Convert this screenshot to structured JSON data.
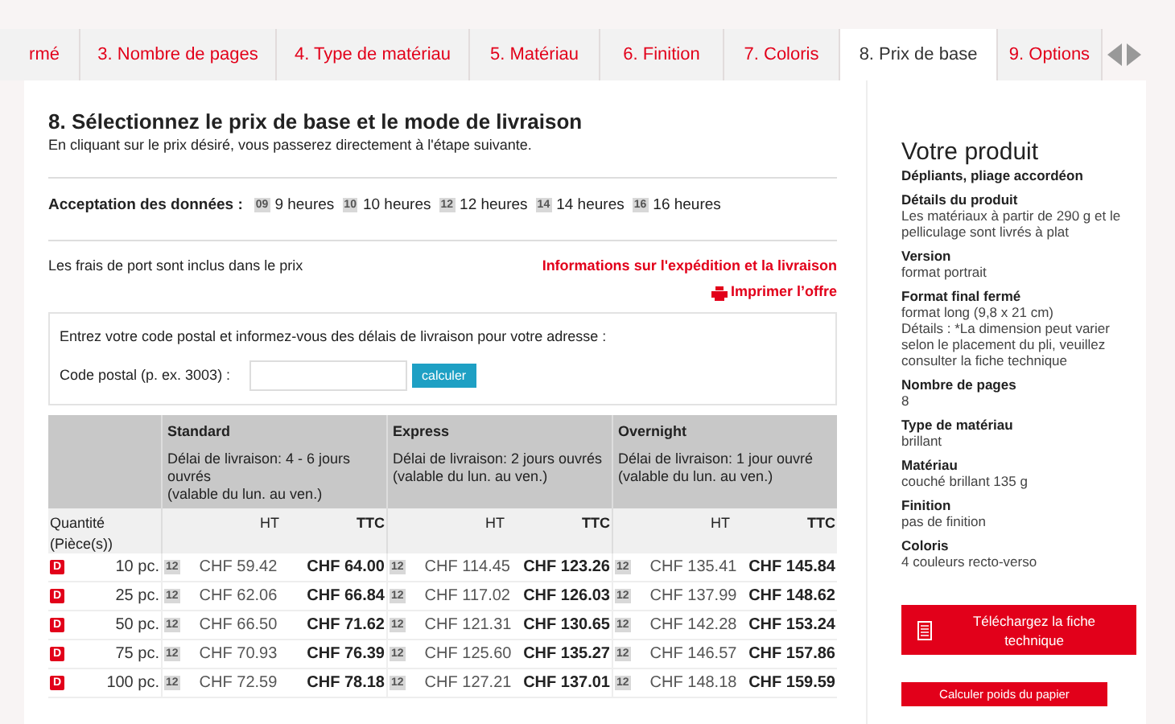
{
  "tabs": [
    {
      "label": "rmé",
      "selected": false
    },
    {
      "label": "3. Nombre de pages",
      "selected": false
    },
    {
      "label": "4. Type de matériau",
      "selected": false
    },
    {
      "label": "5. Matériau",
      "selected": false
    },
    {
      "label": "6. Finition",
      "selected": false
    },
    {
      "label": "7. Coloris",
      "selected": false
    },
    {
      "label": "8. Prix de base",
      "selected": true
    },
    {
      "label": "9. Options",
      "selected": false
    }
  ],
  "heading": "8. Sélectionnez le prix de base et le mode de livraison",
  "subheading": "En cliquant sur le prix désiré, vous passerez directement à l'étape suivante.",
  "acceptance": {
    "label": "Acceptation des données :",
    "times": [
      {
        "badge": "09",
        "label": "9 heures"
      },
      {
        "badge": "10",
        "label": "10 heures"
      },
      {
        "badge": "12",
        "label": "12 heures"
      },
      {
        "badge": "14",
        "label": "14 heures"
      },
      {
        "badge": "16",
        "label": "16 heures"
      }
    ]
  },
  "shipping_note": "Les frais de port sont inclus dans le prix",
  "shipping_link": "Informations sur l'expédition et la livraison",
  "print_link": "Imprimer l’offre",
  "postal": {
    "intro": "Entrez votre code postal et informez-vous des délais de livraison pour votre adresse :",
    "label": "Code postal (p. ex. 3003) :",
    "button": "calculer"
  },
  "table": {
    "options": [
      {
        "name": "Standard",
        "delay": "Délai de livraison: 4 - 6 jours ouvrés",
        "note": "(valable du lun. au ven.)",
        "ht": "HT",
        "ttc": "TTC"
      },
      {
        "name": "Express",
        "delay": "Délai de livraison: 2 jours ouvrés",
        "note": "(valable du lun. au ven.)",
        "ht": "HT",
        "ttc": "TTC"
      },
      {
        "name": "Overnight",
        "delay": "Délai de livraison: 1 jour ouvré",
        "note": "(valable du lun. au ven.)",
        "ht": "HT",
        "ttc": "TTC"
      }
    ],
    "quantity_header": "Quantité (Pièce(s))",
    "rows": [
      {
        "flag": "D",
        "qty": "10 pc.",
        "prices": [
          {
            "badge": "12",
            "ht": "CHF 59.42",
            "ttc": "CHF 64.00"
          },
          {
            "badge": "12",
            "ht": "CHF 114.45",
            "ttc": "CHF 123.26"
          },
          {
            "badge": "12",
            "ht": "CHF 135.41",
            "ttc": "CHF 145.84"
          }
        ]
      },
      {
        "flag": "D",
        "qty": "25 pc.",
        "prices": [
          {
            "badge": "12",
            "ht": "CHF 62.06",
            "ttc": "CHF 66.84"
          },
          {
            "badge": "12",
            "ht": "CHF 117.02",
            "ttc": "CHF 126.03"
          },
          {
            "badge": "12",
            "ht": "CHF 137.99",
            "ttc": "CHF 148.62"
          }
        ]
      },
      {
        "flag": "D",
        "qty": "50 pc.",
        "prices": [
          {
            "badge": "12",
            "ht": "CHF 66.50",
            "ttc": "CHF 71.62"
          },
          {
            "badge": "12",
            "ht": "CHF 121.31",
            "ttc": "CHF 130.65"
          },
          {
            "badge": "12",
            "ht": "CHF 142.28",
            "ttc": "CHF 153.24"
          }
        ]
      },
      {
        "flag": "D",
        "qty": "75 pc.",
        "prices": [
          {
            "badge": "12",
            "ht": "CHF 70.93",
            "ttc": "CHF 76.39"
          },
          {
            "badge": "12",
            "ht": "CHF 125.60",
            "ttc": "CHF 135.27"
          },
          {
            "badge": "12",
            "ht": "CHF 146.57",
            "ttc": "CHF 157.86"
          }
        ]
      },
      {
        "flag": "D",
        "qty": "100 pc.",
        "prices": [
          {
            "badge": "12",
            "ht": "CHF 72.59",
            "ttc": "CHF 78.18"
          },
          {
            "badge": "12",
            "ht": "CHF 127.21",
            "ttc": "CHF 137.01"
          },
          {
            "badge": "12",
            "ht": "CHF 148.18",
            "ttc": "CHF 159.59"
          }
        ]
      }
    ]
  },
  "product": {
    "title": "Votre produit",
    "name": "Dépliants, pliage accordéon",
    "details": [
      {
        "label": "Détails du produit",
        "value": "Les matériaux à partir de 290 g et le pelliculage sont livrés à plat"
      },
      {
        "label": "Version",
        "value": "format portrait"
      },
      {
        "label": "Format final fermé",
        "value": "format long (9,8 x 21 cm)",
        "note": "Détails : *La dimension peut varier selon le placement du pli, veuillez consulter la fiche technique"
      },
      {
        "label": "Nombre de pages",
        "value": "8"
      },
      {
        "label": "Type de matériau",
        "value": "brillant"
      },
      {
        "label": "Matériau",
        "value": "couché brillant 135 g"
      },
      {
        "label": "Finition",
        "value": "pas de finition"
      },
      {
        "label": "Coloris",
        "value": "4 couleurs recto-verso"
      }
    ],
    "download_button": "Téléchargez la fiche technique",
    "weight_button": "Calculer poids du papier"
  }
}
